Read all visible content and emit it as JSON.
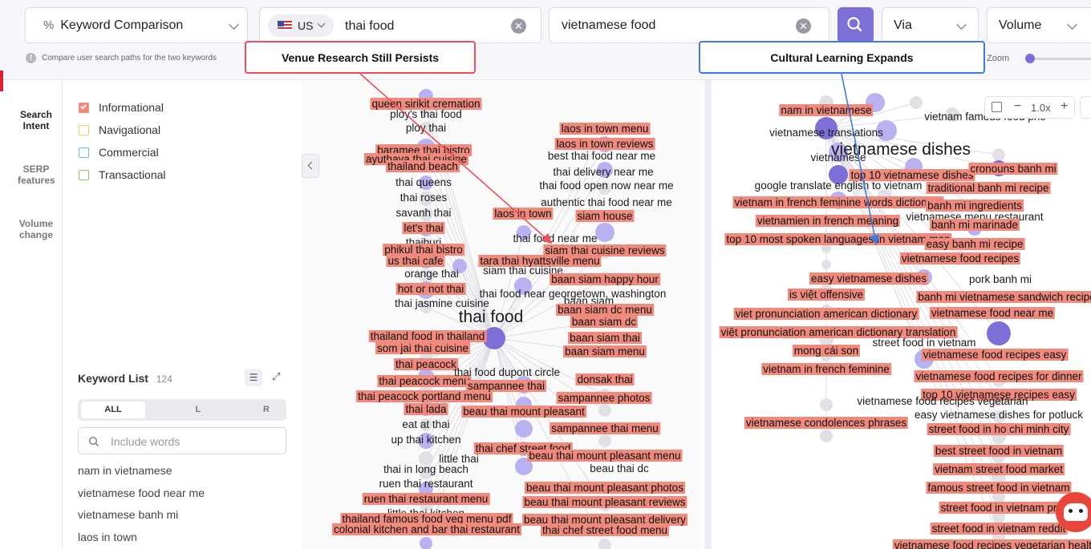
{
  "toolbar": {
    "mode": "Keyword Comparison",
    "country": "US",
    "keyword_left": "thai food",
    "keyword_right": "vietnamese food",
    "via": "Via",
    "metric": "Volume",
    "helper": "Compare user search paths for the two keywords",
    "zoom_label": "Zoom",
    "zoom_value": "1.0x"
  },
  "callouts": {
    "left": "Venue Research Still Persists",
    "right": "Cultural Learning Expands"
  },
  "colors": {
    "accent": "#7c6fd6",
    "highlight": "#ef8a7c",
    "callout_left": "#e8505b",
    "callout_right": "#3e7be0"
  },
  "sidenav": [
    "Search Intent",
    "SERP features",
    "Volume change"
  ],
  "intents": [
    {
      "label": "Informational",
      "color": "#ef8a7c",
      "checked": true
    },
    {
      "label": "Navigational",
      "color": "#f2d04b",
      "checked": false
    },
    {
      "label": "Commercial",
      "color": "#6fb6e8",
      "checked": false
    },
    {
      "label": "Transactional",
      "color": "#8cc66a",
      "checked": false
    }
  ],
  "keyword_list": {
    "title": "Keyword List",
    "count": "124",
    "tabs": [
      "ALL",
      "L",
      "R"
    ],
    "placeholder": "Include words",
    "items": [
      "nam in vietnamese",
      "vietnamese food near me",
      "vietnamese banh mi",
      "laos in town"
    ]
  },
  "graph_left": [
    {
      "t": "queen sirikit cremation",
      "h": true
    },
    {
      "t": "ploy's thai food",
      "h": false
    },
    {
      "t": "ploy thai",
      "h": false
    },
    {
      "t": "baramee thai bistro",
      "h": true
    },
    {
      "t": "ayuthaya thai cuisine",
      "h": true
    },
    {
      "t": "thailand beach",
      "h": true
    },
    {
      "t": "thai queens",
      "h": false
    },
    {
      "t": "thai roses",
      "h": false
    },
    {
      "t": "savanh thai",
      "h": false
    },
    {
      "t": "let's thai",
      "h": true
    },
    {
      "t": "thaiburi",
      "h": false
    },
    {
      "t": "phikul thai bistro",
      "h": true
    },
    {
      "t": "us thai cafe",
      "h": true
    },
    {
      "t": "orange thai",
      "h": false
    },
    {
      "t": "hot or not thai",
      "h": true
    },
    {
      "t": "thai jasmine cuisine",
      "h": false
    },
    {
      "t": "thai food",
      "h": false,
      "big": true
    },
    {
      "t": "thailand food in thailand",
      "h": true
    },
    {
      "t": "som jai thai cuisine",
      "h": true
    },
    {
      "t": "thai peacock",
      "h": true
    },
    {
      "t": "thai peacock menu",
      "h": true
    },
    {
      "t": "thai peacock portland menu",
      "h": true
    },
    {
      "t": "thai lada",
      "h": true
    },
    {
      "t": "eat at thai",
      "h": false
    },
    {
      "t": "up thai kitchen",
      "h": false
    },
    {
      "t": "little thai",
      "h": false
    },
    {
      "t": "thai in long beach",
      "h": false
    },
    {
      "t": "ruen thai restaurant",
      "h": false
    },
    {
      "t": "ruen thai restaurant menu",
      "h": true
    },
    {
      "t": "little thai kitchen",
      "h": false
    },
    {
      "t": "thailand famous food veg menu pdf",
      "h": true
    },
    {
      "t": "colonial kitchen and bar thai restaurant",
      "h": true
    },
    {
      "t": "laos in town menu",
      "h": true
    },
    {
      "t": "laos in town reviews",
      "h": true
    },
    {
      "t": "best thai food near me",
      "h": false
    },
    {
      "t": "thai delivery near me",
      "h": false
    },
    {
      "t": "thai food open now near me",
      "h": false
    },
    {
      "t": "authentic thai food near me",
      "h": false
    },
    {
      "t": "laos in town",
      "h": true
    },
    {
      "t": "siam house",
      "h": true
    },
    {
      "t": "thai food near me",
      "h": false
    },
    {
      "t": "siam thai cuisine reviews",
      "h": true
    },
    {
      "t": "tara thai hyattsville menu",
      "h": true
    },
    {
      "t": "siam thai cuisine",
      "h": false
    },
    {
      "t": "baan siam happy hour",
      "h": true
    },
    {
      "t": "thai food near georgetown, washington",
      "h": false
    },
    {
      "t": "baan siam",
      "h": false
    },
    {
      "t": "baan siam dc menu",
      "h": true
    },
    {
      "t": "baan siam dc",
      "h": true
    },
    {
      "t": "baan siam thai",
      "h": true
    },
    {
      "t": "baan siam menu",
      "h": true
    },
    {
      "t": "thai food dupont circle",
      "h": false
    },
    {
      "t": "donsak thai",
      "h": true
    },
    {
      "t": "sampannee thai",
      "h": true
    },
    {
      "t": "sampannee photos",
      "h": true
    },
    {
      "t": "beau thai mount pleasant",
      "h": true
    },
    {
      "t": "sampannee thai menu",
      "h": true
    },
    {
      "t": "thai chef street food",
      "h": true
    },
    {
      "t": "beau thai mount pleasant menu",
      "h": true
    },
    {
      "t": "beau thai dc",
      "h": false
    },
    {
      "t": "beau thai mount pleasant photos",
      "h": true
    },
    {
      "t": "beau thai mount pleasant reviews",
      "h": true
    },
    {
      "t": "beau thai mount pleasant delivery",
      "h": true
    },
    {
      "t": "thai chef street food menu",
      "h": true
    }
  ],
  "graph_right": [
    {
      "t": "nam in vietnamese",
      "h": true
    },
    {
      "t": "vietnamese translations",
      "h": false
    },
    {
      "t": "vietnam famous food pho",
      "h": false
    },
    {
      "t": "vietnamese dishes",
      "h": false,
      "big": true
    },
    {
      "t": "vietnamese",
      "h": false
    },
    {
      "t": "top 10 vietnamese dishes",
      "h": true
    },
    {
      "t": "cronouns banh mi",
      "h": true
    },
    {
      "t": "google translate english to vietnam",
      "h": false
    },
    {
      "t": "traditional banh mi recipe",
      "h": true
    },
    {
      "t": "vietnam in french feminine words dictionary",
      "h": true
    },
    {
      "t": "banh mi ingredients",
      "h": true
    },
    {
      "t": "vietnamese menu restaurant",
      "h": false
    },
    {
      "t": "vietnamien in french meaning",
      "h": true
    },
    {
      "t": "banh mi marinade",
      "h": true
    },
    {
      "t": "top 10 most spoken languages in vietnam map",
      "h": true
    },
    {
      "t": "easy banh mi recipe",
      "h": true
    },
    {
      "t": "vietnamese food recipes",
      "h": true
    },
    {
      "t": "easy vietnamese dishes",
      "h": true
    },
    {
      "t": "pork banh mi",
      "h": false
    },
    {
      "t": "is việt offensive",
      "h": true
    },
    {
      "t": "banh mi vietnamese sandwich recipe",
      "h": true
    },
    {
      "t": "viet pronunciation american dictionary",
      "h": true
    },
    {
      "t": "vietnamese food near me",
      "h": true
    },
    {
      "t": "việt pronunciation american dictionary translation",
      "h": true
    },
    {
      "t": "street food in vietnam",
      "h": false
    },
    {
      "t": "mong cái son",
      "h": true
    },
    {
      "t": "vietnamese food recipes easy",
      "h": true
    },
    {
      "t": "vietnam in french feminine",
      "h": true
    },
    {
      "t": "vietnamese food recipes for dinner",
      "h": true
    },
    {
      "t": "top 10 vietnamese recipes easy",
      "h": true
    },
    {
      "t": "vietnamese food recipes vegetarian",
      "h": false
    },
    {
      "t": "easy vietnamese dishes for potluck",
      "h": false
    },
    {
      "t": "vietnamese condolences phrases",
      "h": true
    },
    {
      "t": "street food in ho chi minh city",
      "h": true
    },
    {
      "t": "best street food in vietnam",
      "h": true
    },
    {
      "t": "vietnam street food market",
      "h": true
    },
    {
      "t": "famous street food in vietnam",
      "h": true
    },
    {
      "t": "street food in vietnam pr",
      "h": true
    },
    {
      "t": "street food in vietnam reddit",
      "h": true
    },
    {
      "t": "vietnamese food recipes vegetarian healthy",
      "h": true
    }
  ]
}
